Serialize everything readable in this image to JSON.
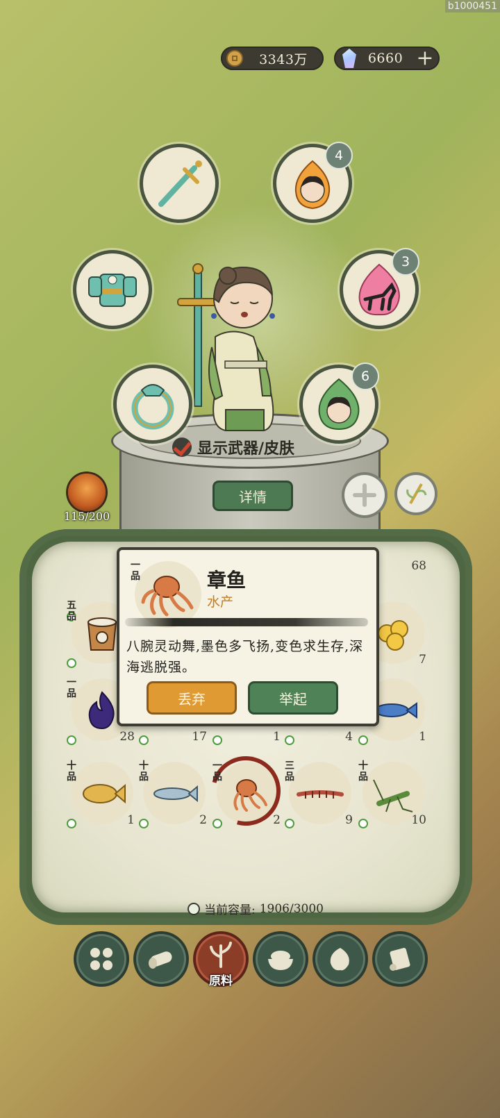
{
  "watermark": "b1000451",
  "currency": {
    "coins": "3343万",
    "gems": "6660",
    "add_label": "+"
  },
  "equipment": {
    "soul_badge": "4",
    "beast_badge": "3",
    "spirit_badge": "6"
  },
  "character": {
    "show_weapon_skin_label": "显示武器/皮肤",
    "detail_button": "详情",
    "level_text": "115/200"
  },
  "inventory": {
    "items": [
      {
        "grade": "五品",
        "count": "",
        "icon": "wooden-bucket"
      },
      {
        "grade": "一品",
        "count": "28",
        "icon": "purple-flame"
      },
      {
        "grade": "",
        "count": "17",
        "icon": "hidden"
      },
      {
        "grade": "",
        "count": "1",
        "icon": "hidden"
      },
      {
        "grade": "",
        "count": "4",
        "icon": "hidden"
      },
      {
        "grade": "",
        "count": "68",
        "icon": "hidden"
      },
      {
        "grade": "",
        "count": "7",
        "icon": "golden-nuggets"
      },
      {
        "grade": "",
        "count": "1",
        "icon": "blue-fish"
      },
      {
        "grade": "十品",
        "count": "1",
        "icon": "golden-fish"
      },
      {
        "grade": "十品",
        "count": "2",
        "icon": "silver-fish"
      },
      {
        "grade": "一品",
        "count": "2",
        "icon": "octopus"
      },
      {
        "grade": "三品",
        "count": "9",
        "icon": "centipede"
      },
      {
        "grade": "十品",
        "count": "10",
        "icon": "grasshopper"
      }
    ],
    "capacity_label": "当前容量:",
    "capacity_value": "1906/3000"
  },
  "popup": {
    "grade": "一品",
    "name": "章鱼",
    "category": "水产",
    "description": "八腕灵动舞,墨色多飞扬,变色求生存,深海逃脱强。",
    "discard_button": "丢弃",
    "lift_button": "举起"
  },
  "tabs": [
    {
      "icon": "grid-icon",
      "label": ""
    },
    {
      "icon": "log-icon",
      "label": ""
    },
    {
      "icon": "sprout-icon",
      "label": "原料"
    },
    {
      "icon": "rice-bowl-icon",
      "label": ""
    },
    {
      "icon": "leaf-icon",
      "label": ""
    },
    {
      "icon": "scroll-icon",
      "label": ""
    }
  ],
  "colors": {
    "accent_orange": "#e09a33",
    "accent_green": "#4f8256",
    "active_tab": "#8c3d28"
  }
}
